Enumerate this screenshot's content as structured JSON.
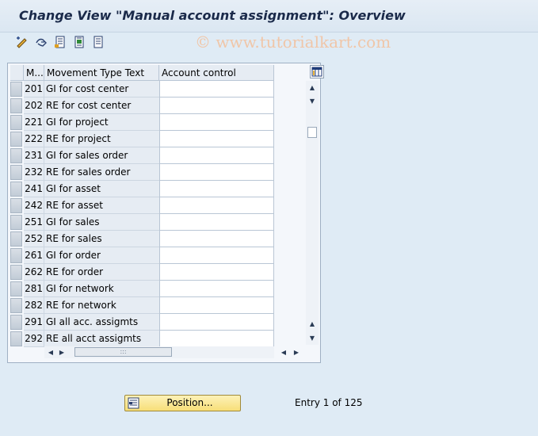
{
  "window": {
    "title": "Change View \"Manual account assignment\": Overview"
  },
  "toolbar": {
    "buttons": [
      {
        "name": "change-display-icon"
      },
      {
        "name": "undo-icon"
      },
      {
        "name": "select-all-icon"
      },
      {
        "name": "select-block-icon"
      },
      {
        "name": "deselect-all-icon"
      }
    ]
  },
  "watermark": "© www.tutorialkart.com",
  "table": {
    "columns": [
      "M...",
      "Movement Type Text",
      "Account control"
    ],
    "rows": [
      {
        "mv": "201",
        "text": "GI for cost center",
        "acc": ""
      },
      {
        "mv": "202",
        "text": "RE for cost center",
        "acc": ""
      },
      {
        "mv": "221",
        "text": "GI for project",
        "acc": ""
      },
      {
        "mv": "222",
        "text": "RE for project",
        "acc": ""
      },
      {
        "mv": "231",
        "text": "GI for sales order",
        "acc": ""
      },
      {
        "mv": "232",
        "text": "RE for sales order",
        "acc": ""
      },
      {
        "mv": "241",
        "text": "GI for asset",
        "acc": ""
      },
      {
        "mv": "242",
        "text": "RE for asset",
        "acc": ""
      },
      {
        "mv": "251",
        "text": "GI for sales",
        "acc": ""
      },
      {
        "mv": "252",
        "text": "RE for sales",
        "acc": ""
      },
      {
        "mv": "261",
        "text": "GI for order",
        "acc": ""
      },
      {
        "mv": "262",
        "text": "RE for order",
        "acc": ""
      },
      {
        "mv": "281",
        "text": "GI for network",
        "acc": ""
      },
      {
        "mv": "282",
        "text": "RE for network",
        "acc": ""
      },
      {
        "mv": "291",
        "text": "GI all acc. assigmts",
        "acc": ""
      },
      {
        "mv": "292",
        "text": "RE all acct assigmts",
        "acc": ""
      }
    ]
  },
  "footer": {
    "position_label": "Position...",
    "entry_text": "Entry 1 of 125"
  },
  "colors": {
    "background": "#dfebf5",
    "title": "#1a2a4a",
    "position_button": "#f7df78"
  }
}
